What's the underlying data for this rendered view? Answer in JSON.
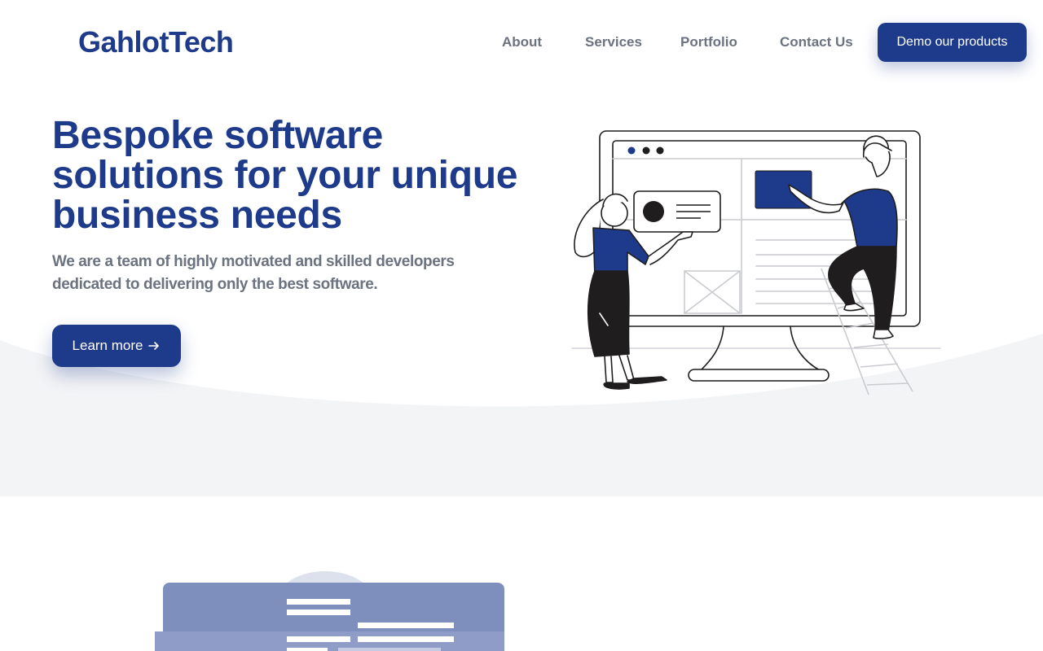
{
  "header": {
    "logo": "GahlotTech",
    "nav": {
      "about": "About",
      "services": "Services",
      "portfolio": "Portfolio",
      "contact": "Contact Us"
    },
    "demo_button": "Demo our products"
  },
  "hero": {
    "title": "Bespoke software solutions for your unique business needs",
    "subtitle": "We are a team of highly motivated and skilled developers dedicated to delivering only the best software.",
    "cta": "Learn more",
    "cta_icon": "arrow-right-icon",
    "illustration": "team-building-website-illustration"
  },
  "section2": {
    "illustration": "web-page-layout-illustration"
  },
  "colors": {
    "brand": "#1e3a8a",
    "muted_text": "#6b7280",
    "wave_bg": "#f3f4f6"
  }
}
